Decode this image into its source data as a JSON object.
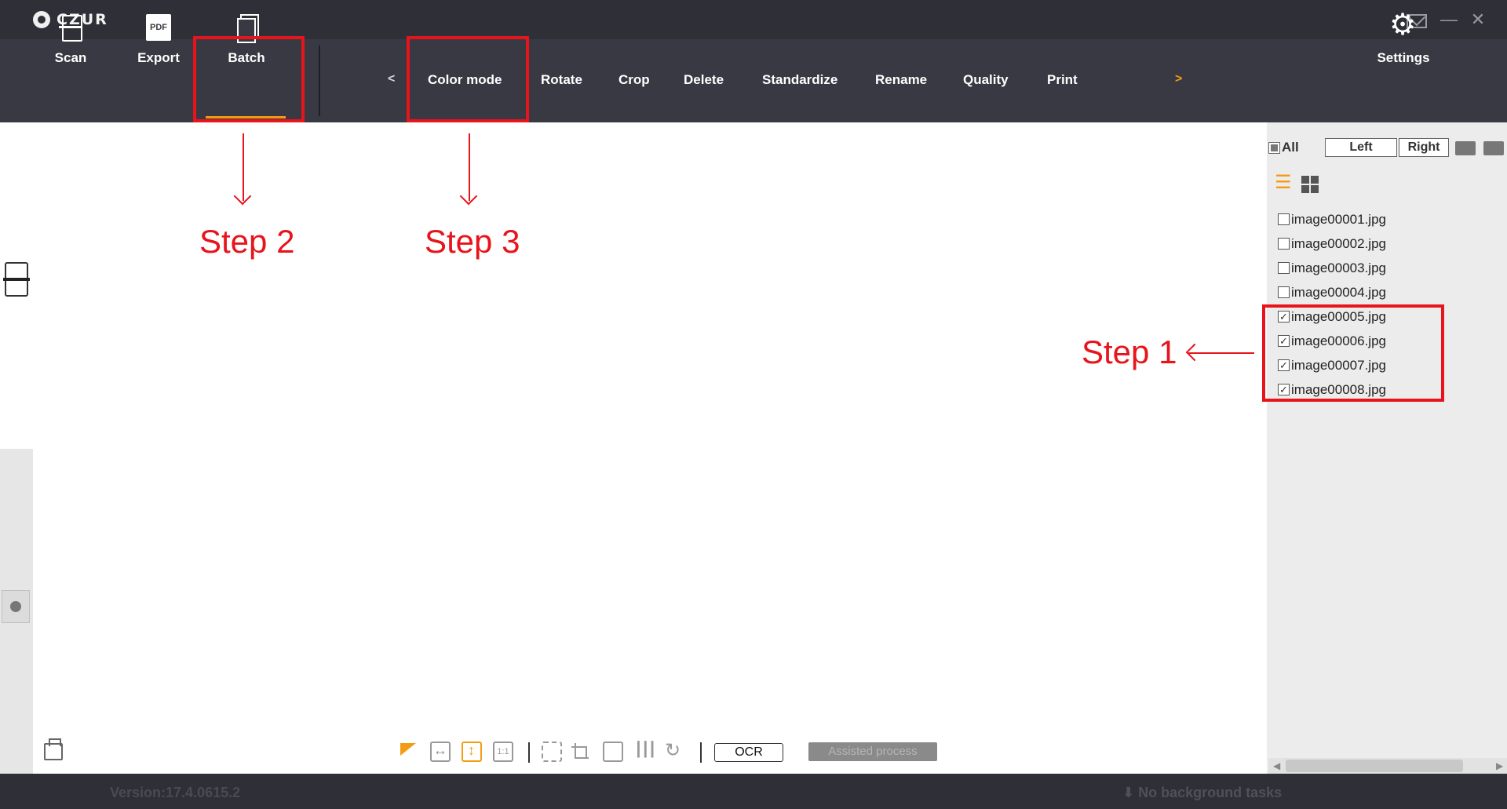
{
  "app": {
    "logo_text": "CZUR"
  },
  "toolbar": {
    "scan_label": "Scan",
    "export_label": "Export",
    "batch_label": "Batch",
    "prev_arrow": "<",
    "next_arrow": ">",
    "menu": [
      "Color mode",
      "Rotate",
      "Crop",
      "Delete",
      "Standardize",
      "Rename",
      "Quality",
      "Print"
    ],
    "settings_label": "Settings"
  },
  "bottom_tools": {
    "ocr_label": "OCR",
    "assisted_label": "Assisted process",
    "actual_size_label": "1:1"
  },
  "right_panel": {
    "all_label": "All",
    "left_label": "Left",
    "right_label": "Right",
    "files": [
      {
        "name": "image00001.jpg",
        "checked": false
      },
      {
        "name": "image00002.jpg",
        "checked": false
      },
      {
        "name": "image00003.jpg",
        "checked": false
      },
      {
        "name": "image00004.jpg",
        "checked": false
      },
      {
        "name": "image00005.jpg",
        "checked": true
      },
      {
        "name": "image00006.jpg",
        "checked": true
      },
      {
        "name": "image00007.jpg",
        "checked": true
      },
      {
        "name": "image00008.jpg",
        "checked": true
      }
    ]
  },
  "status": {
    "version": "Version:17.4.0615.2",
    "background_tasks": "No background tasks"
  },
  "annotations": {
    "step1": "Step 1",
    "step2": "Step 2",
    "step3": "Step 3"
  },
  "colors": {
    "accent": "#f39c12",
    "annotation_red": "#e8141c",
    "toolbar_bg": "#383942"
  }
}
